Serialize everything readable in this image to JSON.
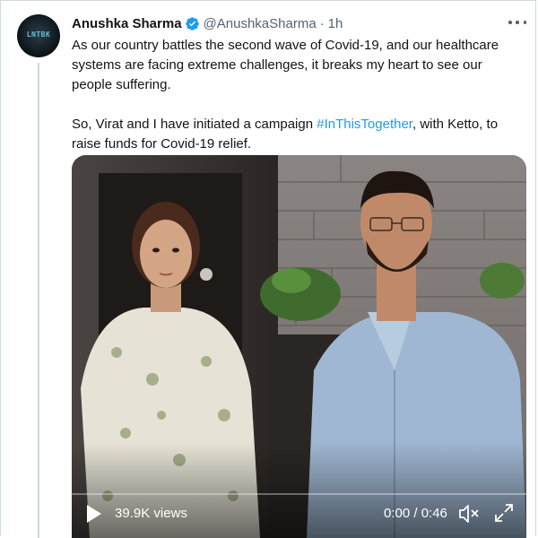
{
  "tweet": {
    "display_name": "Anushka Sharma",
    "handle": "@AnushkaSharma",
    "separator": "·",
    "time": "1h",
    "avatar_text": "LNTBK",
    "paragraph1": "As our country battles the second wave of Covid-19, and our healthcare systems are facing extreme challenges, it breaks my heart to see our people suffering.",
    "paragraph2_before": "So, Virat and I have initiated a campaign ",
    "hashtag": "#InThisTogether",
    "paragraph2_after": ", with Ketto, to raise funds for Covid-19 relief."
  },
  "video": {
    "views": "39.9K views",
    "timecode": "0:00 / 0:46",
    "progress": 0
  },
  "colors": {
    "accent": "#1d9bf0",
    "text": "#0f1419",
    "secondary": "#536471",
    "border": "#cfd9de"
  },
  "icons": [
    "verified-badge-icon",
    "more-options-icon",
    "play-icon",
    "mute-icon",
    "expand-icon"
  ]
}
